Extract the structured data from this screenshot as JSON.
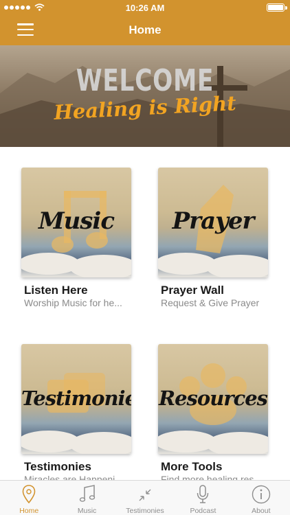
{
  "status": {
    "time": "10:26 AM"
  },
  "header": {
    "title": "Home",
    "menu_icon": "hamburger-menu-icon"
  },
  "hero": {
    "headline": "WELCOME",
    "tagline": "Healing is Right",
    "accent": "#f2a422"
  },
  "cards": [
    {
      "tile_text": "Music",
      "title": "Listen Here",
      "subtitle": "Worship Music for he..."
    },
    {
      "tile_text": "Prayer",
      "title": "Prayer Wall",
      "subtitle": "Request & Give Prayer"
    },
    {
      "tile_text": "Testimonies",
      "title": "Testimonies",
      "subtitle": "Miracles are Happeni..."
    },
    {
      "tile_text": "Resources",
      "title": "More Tools",
      "subtitle": "Find more healing res..."
    }
  ],
  "tabs": [
    {
      "label": "Home",
      "icon": "location-pin-icon",
      "active": true
    },
    {
      "label": "Music",
      "icon": "music-note-icon",
      "active": false
    },
    {
      "label": "Testimonies",
      "icon": "compress-arrows-icon",
      "active": false
    },
    {
      "label": "Podcast",
      "icon": "microphone-icon",
      "active": false
    },
    {
      "label": "About",
      "icon": "info-icon",
      "active": false
    }
  ],
  "colors": {
    "brand": "#d2932e",
    "tab_inactive": "#8e8e8e",
    "title_text": "#1a1a1a",
    "subtitle_text": "#8a8a8a"
  }
}
